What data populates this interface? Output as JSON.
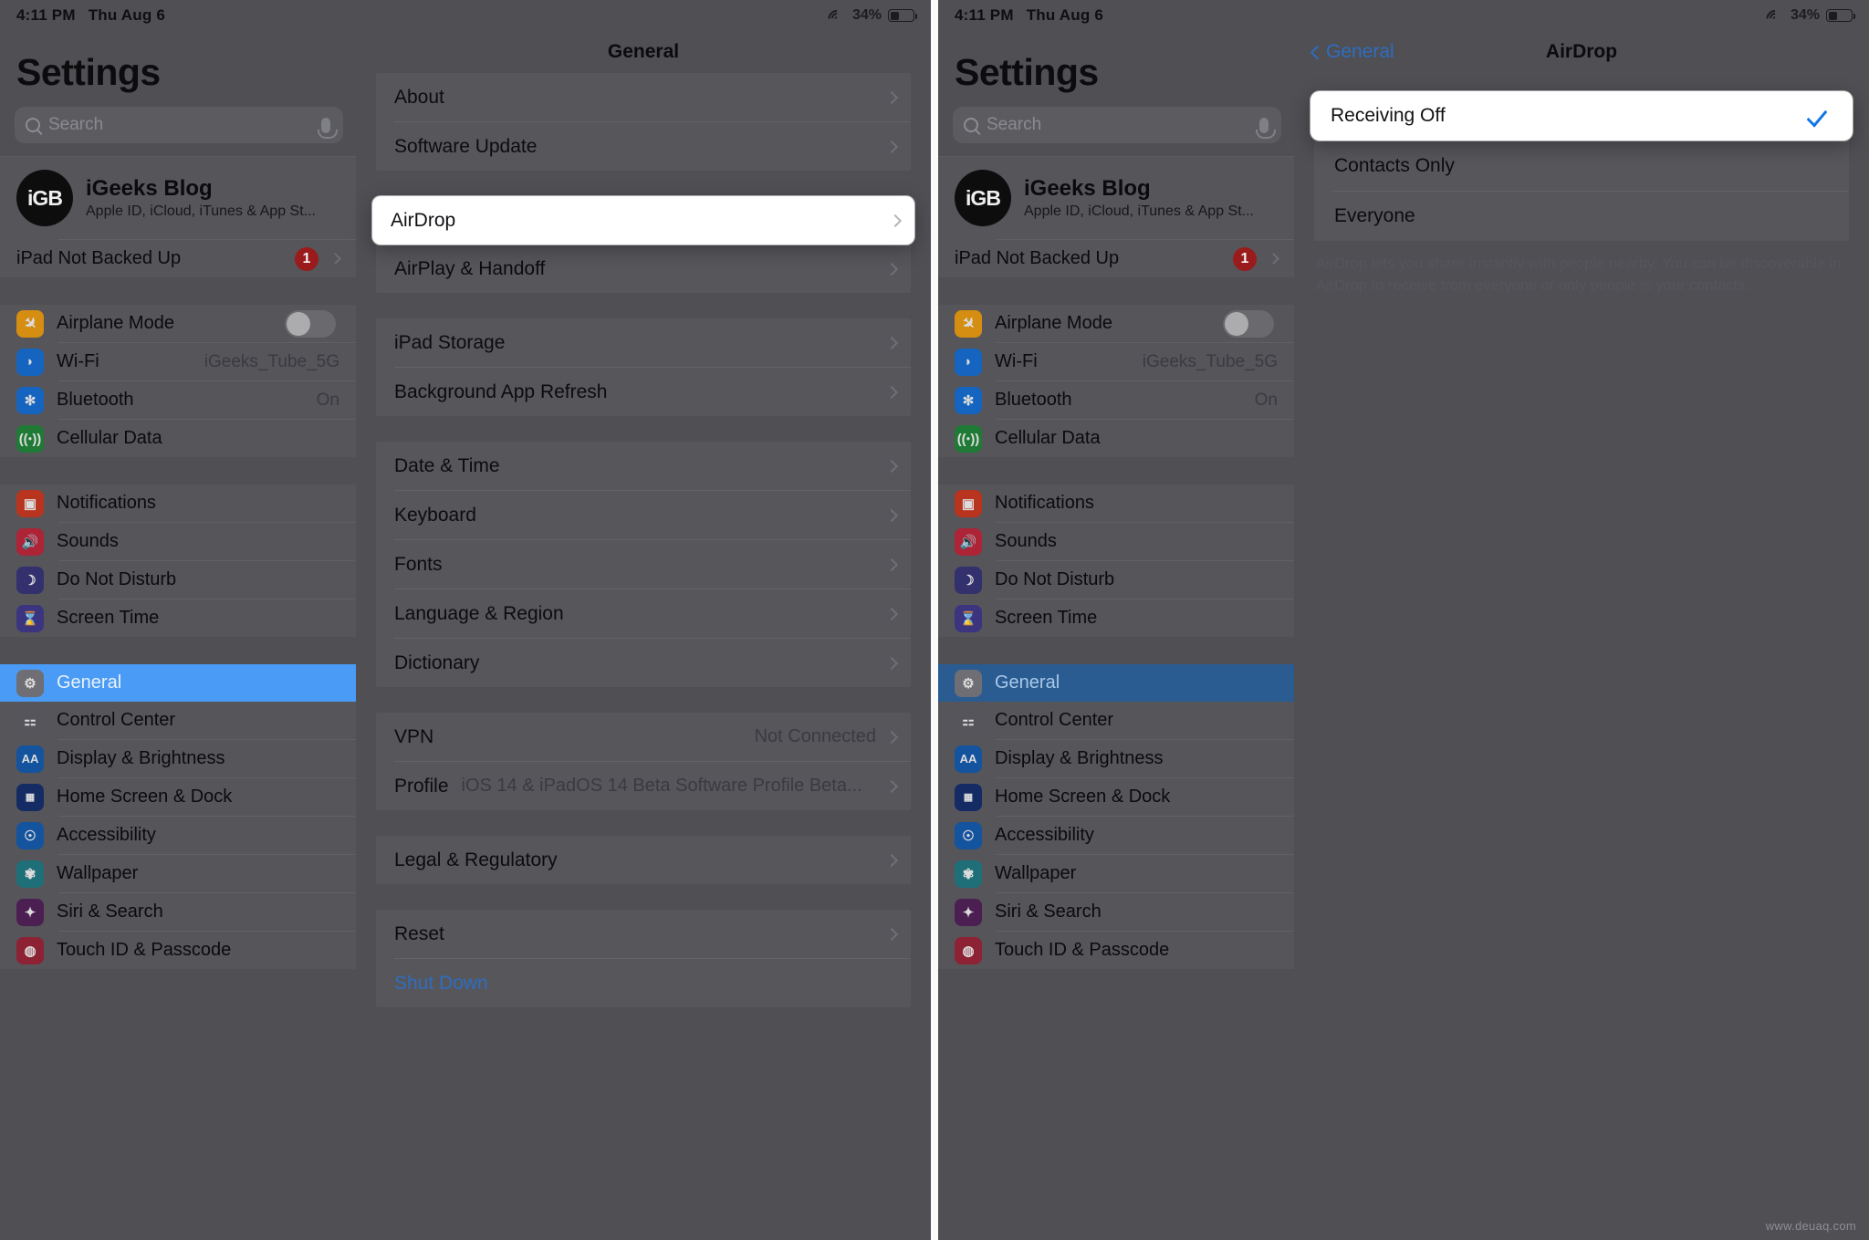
{
  "statusbar": {
    "time": "4:11 PM",
    "date": "Thu Aug 6",
    "battery_pct": "34%",
    "wifi_icon": "wifi-icon",
    "battery_icon": "battery-icon"
  },
  "sidebar": {
    "title": "Settings",
    "search": {
      "placeholder": "Search",
      "search_icon": "search-icon",
      "mic_icon": "microphone-icon"
    },
    "account": {
      "initials": "iGB",
      "name": "iGeeks Blog",
      "subtitle": "Apple ID, iCloud, iTunes & App St..."
    },
    "backup": {
      "label": "iPad Not Backed Up",
      "badge": "1"
    },
    "group1": [
      {
        "label": "Airplane Mode",
        "icon": "airplane-icon",
        "accessory": "toggle-off"
      },
      {
        "label": "Wi-Fi",
        "icon": "wifi-icon",
        "value": "iGeeks_Tube_5G"
      },
      {
        "label": "Bluetooth",
        "icon": "bluetooth-icon",
        "value": "On"
      },
      {
        "label": "Cellular Data",
        "icon": "cellular-icon",
        "value": ""
      }
    ],
    "group2": [
      {
        "label": "Notifications",
        "icon": "notifications-icon"
      },
      {
        "label": "Sounds",
        "icon": "sounds-icon"
      },
      {
        "label": "Do Not Disturb",
        "icon": "moon-icon"
      },
      {
        "label": "Screen Time",
        "icon": "hourglass-icon"
      }
    ],
    "group3": [
      {
        "label": "General",
        "icon": "gear-icon",
        "selected": true
      },
      {
        "label": "Control Center",
        "icon": "sliders-icon"
      },
      {
        "label": "Display & Brightness",
        "icon": "aa-icon"
      },
      {
        "label": "Home Screen & Dock",
        "icon": "grid-icon"
      },
      {
        "label": "Accessibility",
        "icon": "accessibility-icon"
      },
      {
        "label": "Wallpaper",
        "icon": "flower-icon"
      },
      {
        "label": "Siri & Search",
        "icon": "siri-icon"
      },
      {
        "label": "Touch ID & Passcode",
        "icon": "fingerprint-icon"
      }
    ]
  },
  "general_pane": {
    "nav_title": "General",
    "sections": [
      {
        "rows": [
          {
            "label": "About",
            "value": "",
            "chevron": true
          },
          {
            "label": "Software Update",
            "value": "",
            "chevron": true
          }
        ]
      },
      {
        "rows": [
          {
            "label": "AirDrop",
            "value": "",
            "chevron": true,
            "highlighted": true
          },
          {
            "label": "AirPlay & Handoff",
            "value": "",
            "chevron": true
          }
        ]
      },
      {
        "rows": [
          {
            "label": "iPad Storage",
            "value": "",
            "chevron": true
          },
          {
            "label": "Background App Refresh",
            "value": "",
            "chevron": true
          }
        ]
      },
      {
        "rows": [
          {
            "label": "Date & Time",
            "value": "",
            "chevron": true
          },
          {
            "label": "Keyboard",
            "value": "",
            "chevron": true
          },
          {
            "label": "Fonts",
            "value": "",
            "chevron": true
          },
          {
            "label": "Language & Region",
            "value": "",
            "chevron": true
          },
          {
            "label": "Dictionary",
            "value": "",
            "chevron": true
          }
        ]
      },
      {
        "rows": [
          {
            "label": "VPN",
            "value": "Not Connected",
            "chevron": true
          },
          {
            "label": "Profile",
            "value": "iOS 14 & iPadOS 14 Beta Software Profile Beta...",
            "chevron": true
          }
        ]
      },
      {
        "rows": [
          {
            "label": "Legal & Regulatory",
            "value": "",
            "chevron": true
          }
        ]
      },
      {
        "rows": [
          {
            "label": "Reset",
            "value": "",
            "chevron": true
          },
          {
            "label": "Shut Down",
            "value": "",
            "chevron": false,
            "link": true
          }
        ]
      }
    ]
  },
  "airdrop_pane": {
    "back_label": "General",
    "back_icon": "chevron-left-icon",
    "nav_title": "AirDrop",
    "options": [
      {
        "label": "Receiving Off",
        "selected": true,
        "check_icon": "checkmark-icon"
      },
      {
        "label": "Contacts Only",
        "selected": false
      },
      {
        "label": "Everyone",
        "selected": false
      }
    ],
    "note": "AirDrop lets you share instantly with people nearby. You can be discoverable in AirDrop to receive from everyone or only people in your contacts."
  },
  "watermark": "www.deuaq.com",
  "colors": {
    "accent_blue": "#4a9bf5",
    "link_blue": "#2f6dbf",
    "check_blue": "#1076e8",
    "badge_red": "#9a1b1b"
  }
}
